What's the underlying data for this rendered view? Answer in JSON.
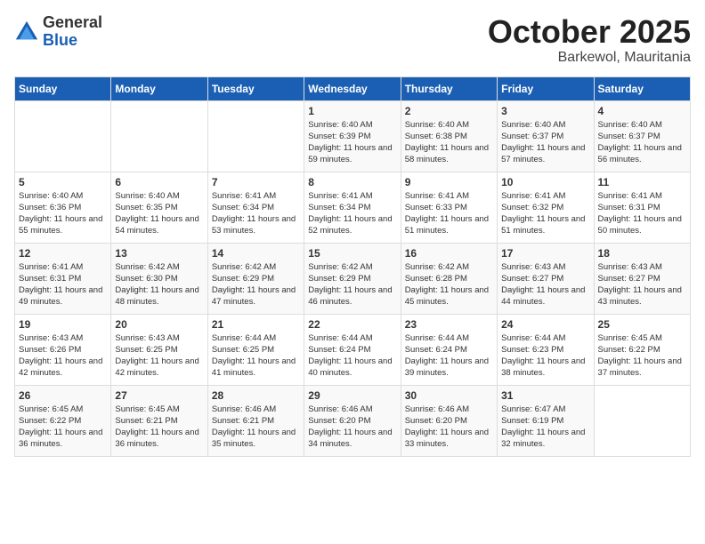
{
  "logo": {
    "general": "General",
    "blue": "Blue"
  },
  "header": {
    "month": "October 2025",
    "location": "Barkewol, Mauritania"
  },
  "weekdays": [
    "Sunday",
    "Monday",
    "Tuesday",
    "Wednesday",
    "Thursday",
    "Friday",
    "Saturday"
  ],
  "weeks": [
    [
      {
        "day": "",
        "sunrise": "",
        "sunset": "",
        "daylight": ""
      },
      {
        "day": "",
        "sunrise": "",
        "sunset": "",
        "daylight": ""
      },
      {
        "day": "",
        "sunrise": "",
        "sunset": "",
        "daylight": ""
      },
      {
        "day": "1",
        "sunrise": "Sunrise: 6:40 AM",
        "sunset": "Sunset: 6:39 PM",
        "daylight": "Daylight: 11 hours and 59 minutes."
      },
      {
        "day": "2",
        "sunrise": "Sunrise: 6:40 AM",
        "sunset": "Sunset: 6:38 PM",
        "daylight": "Daylight: 11 hours and 58 minutes."
      },
      {
        "day": "3",
        "sunrise": "Sunrise: 6:40 AM",
        "sunset": "Sunset: 6:37 PM",
        "daylight": "Daylight: 11 hours and 57 minutes."
      },
      {
        "day": "4",
        "sunrise": "Sunrise: 6:40 AM",
        "sunset": "Sunset: 6:37 PM",
        "daylight": "Daylight: 11 hours and 56 minutes."
      }
    ],
    [
      {
        "day": "5",
        "sunrise": "Sunrise: 6:40 AM",
        "sunset": "Sunset: 6:36 PM",
        "daylight": "Daylight: 11 hours and 55 minutes."
      },
      {
        "day": "6",
        "sunrise": "Sunrise: 6:40 AM",
        "sunset": "Sunset: 6:35 PM",
        "daylight": "Daylight: 11 hours and 54 minutes."
      },
      {
        "day": "7",
        "sunrise": "Sunrise: 6:41 AM",
        "sunset": "Sunset: 6:34 PM",
        "daylight": "Daylight: 11 hours and 53 minutes."
      },
      {
        "day": "8",
        "sunrise": "Sunrise: 6:41 AM",
        "sunset": "Sunset: 6:34 PM",
        "daylight": "Daylight: 11 hours and 52 minutes."
      },
      {
        "day": "9",
        "sunrise": "Sunrise: 6:41 AM",
        "sunset": "Sunset: 6:33 PM",
        "daylight": "Daylight: 11 hours and 51 minutes."
      },
      {
        "day": "10",
        "sunrise": "Sunrise: 6:41 AM",
        "sunset": "Sunset: 6:32 PM",
        "daylight": "Daylight: 11 hours and 51 minutes."
      },
      {
        "day": "11",
        "sunrise": "Sunrise: 6:41 AM",
        "sunset": "Sunset: 6:31 PM",
        "daylight": "Daylight: 11 hours and 50 minutes."
      }
    ],
    [
      {
        "day": "12",
        "sunrise": "Sunrise: 6:41 AM",
        "sunset": "Sunset: 6:31 PM",
        "daylight": "Daylight: 11 hours and 49 minutes."
      },
      {
        "day": "13",
        "sunrise": "Sunrise: 6:42 AM",
        "sunset": "Sunset: 6:30 PM",
        "daylight": "Daylight: 11 hours and 48 minutes."
      },
      {
        "day": "14",
        "sunrise": "Sunrise: 6:42 AM",
        "sunset": "Sunset: 6:29 PM",
        "daylight": "Daylight: 11 hours and 47 minutes."
      },
      {
        "day": "15",
        "sunrise": "Sunrise: 6:42 AM",
        "sunset": "Sunset: 6:29 PM",
        "daylight": "Daylight: 11 hours and 46 minutes."
      },
      {
        "day": "16",
        "sunrise": "Sunrise: 6:42 AM",
        "sunset": "Sunset: 6:28 PM",
        "daylight": "Daylight: 11 hours and 45 minutes."
      },
      {
        "day": "17",
        "sunrise": "Sunrise: 6:43 AM",
        "sunset": "Sunset: 6:27 PM",
        "daylight": "Daylight: 11 hours and 44 minutes."
      },
      {
        "day": "18",
        "sunrise": "Sunrise: 6:43 AM",
        "sunset": "Sunset: 6:27 PM",
        "daylight": "Daylight: 11 hours and 43 minutes."
      }
    ],
    [
      {
        "day": "19",
        "sunrise": "Sunrise: 6:43 AM",
        "sunset": "Sunset: 6:26 PM",
        "daylight": "Daylight: 11 hours and 42 minutes."
      },
      {
        "day": "20",
        "sunrise": "Sunrise: 6:43 AM",
        "sunset": "Sunset: 6:25 PM",
        "daylight": "Daylight: 11 hours and 42 minutes."
      },
      {
        "day": "21",
        "sunrise": "Sunrise: 6:44 AM",
        "sunset": "Sunset: 6:25 PM",
        "daylight": "Daylight: 11 hours and 41 minutes."
      },
      {
        "day": "22",
        "sunrise": "Sunrise: 6:44 AM",
        "sunset": "Sunset: 6:24 PM",
        "daylight": "Daylight: 11 hours and 40 minutes."
      },
      {
        "day": "23",
        "sunrise": "Sunrise: 6:44 AM",
        "sunset": "Sunset: 6:24 PM",
        "daylight": "Daylight: 11 hours and 39 minutes."
      },
      {
        "day": "24",
        "sunrise": "Sunrise: 6:44 AM",
        "sunset": "Sunset: 6:23 PM",
        "daylight": "Daylight: 11 hours and 38 minutes."
      },
      {
        "day": "25",
        "sunrise": "Sunrise: 6:45 AM",
        "sunset": "Sunset: 6:22 PM",
        "daylight": "Daylight: 11 hours and 37 minutes."
      }
    ],
    [
      {
        "day": "26",
        "sunrise": "Sunrise: 6:45 AM",
        "sunset": "Sunset: 6:22 PM",
        "daylight": "Daylight: 11 hours and 36 minutes."
      },
      {
        "day": "27",
        "sunrise": "Sunrise: 6:45 AM",
        "sunset": "Sunset: 6:21 PM",
        "daylight": "Daylight: 11 hours and 36 minutes."
      },
      {
        "day": "28",
        "sunrise": "Sunrise: 6:46 AM",
        "sunset": "Sunset: 6:21 PM",
        "daylight": "Daylight: 11 hours and 35 minutes."
      },
      {
        "day": "29",
        "sunrise": "Sunrise: 6:46 AM",
        "sunset": "Sunset: 6:20 PM",
        "daylight": "Daylight: 11 hours and 34 minutes."
      },
      {
        "day": "30",
        "sunrise": "Sunrise: 6:46 AM",
        "sunset": "Sunset: 6:20 PM",
        "daylight": "Daylight: 11 hours and 33 minutes."
      },
      {
        "day": "31",
        "sunrise": "Sunrise: 6:47 AM",
        "sunset": "Sunset: 6:19 PM",
        "daylight": "Daylight: 11 hours and 32 minutes."
      },
      {
        "day": "",
        "sunrise": "",
        "sunset": "",
        "daylight": ""
      }
    ]
  ]
}
